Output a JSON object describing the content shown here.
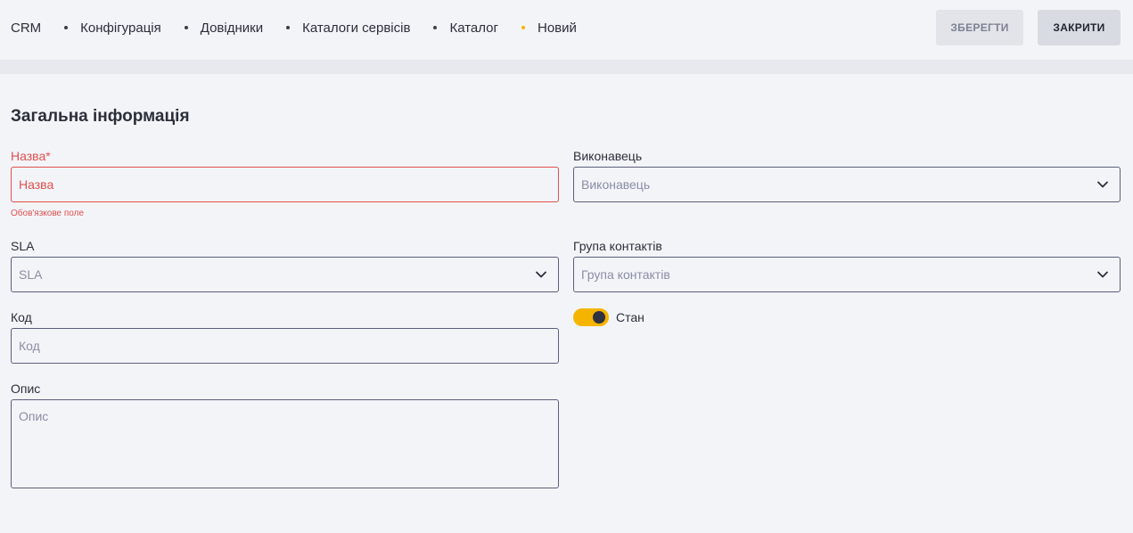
{
  "breadcrumb": [
    {
      "label": "CRM"
    },
    {
      "label": "Конфігурація"
    },
    {
      "label": "Довідники"
    },
    {
      "label": "Каталоги сервісів"
    },
    {
      "label": "Каталог"
    },
    {
      "label": "Новий"
    }
  ],
  "toolbar": {
    "save_label": "ЗБЕРЕГТИ",
    "close_label": "ЗАКРИТИ"
  },
  "colors": {
    "accent": "#f5b400",
    "error": "#e0504f",
    "border": "#5b5f7b",
    "background": "#f3f4f8"
  },
  "section": {
    "title": "Загальна інформація"
  },
  "form": {
    "name": {
      "label": "Назва*",
      "placeholder": "Назва",
      "error": "Обов'язкове поле"
    },
    "executor": {
      "label": "Виконавець",
      "placeholder": "Виконавець",
      "icon": "chevron-down-icon"
    },
    "sla": {
      "label": "SLA",
      "placeholder": "SLA",
      "icon": "chevron-down-icon"
    },
    "contact_group": {
      "label": "Група контактів",
      "placeholder": "Група контактів",
      "icon": "chevron-down-icon"
    },
    "code": {
      "label": "Код",
      "placeholder": "Код"
    },
    "state": {
      "label": "Стан",
      "on": true
    },
    "description": {
      "label": "Опис",
      "placeholder": "Опис"
    }
  }
}
